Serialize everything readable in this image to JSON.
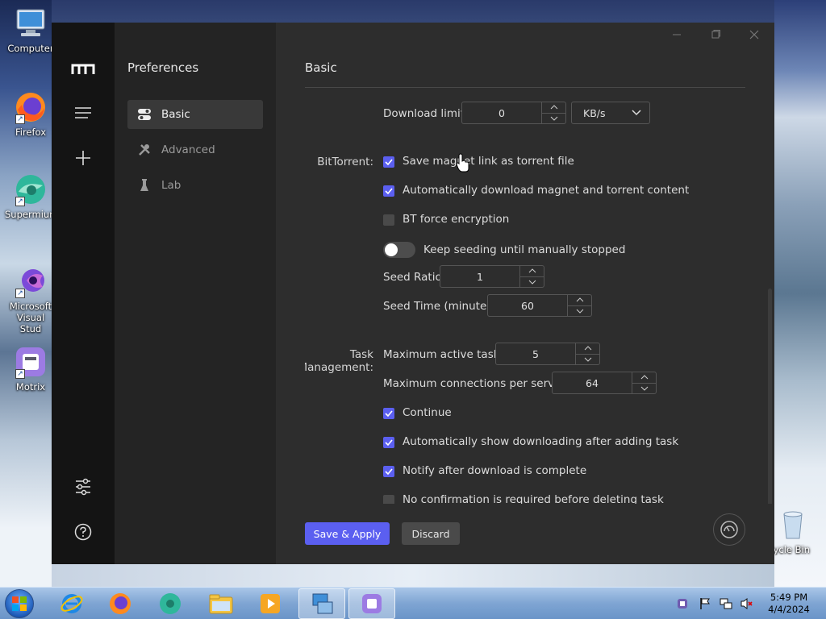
{
  "desktop": {
    "icons": [
      {
        "label": "Computer"
      },
      {
        "label": "Firefox"
      },
      {
        "label": "Supermium"
      },
      {
        "label": "Microsoft Visual Stud"
      },
      {
        "label": "Motrix"
      },
      {
        "label": "Recycle Bin"
      }
    ]
  },
  "app": {
    "sidebar_nav_title": "Preferences",
    "nav_items": [
      {
        "label": "Basic",
        "icon": "toggle-switches-icon",
        "active": true
      },
      {
        "label": "Advanced",
        "icon": "wrench-screwdriver-icon",
        "active": false
      },
      {
        "label": "Lab",
        "icon": "flask-icon",
        "active": false
      }
    ],
    "page_title": "Basic",
    "download_limit": {
      "label": "Download limit",
      "value": "0",
      "unit": "KB/s"
    },
    "bittorrent": {
      "label": "BitTorrent:",
      "save_magnet": "Save magnet link as torrent file",
      "auto_download": "Automatically download magnet and torrent content",
      "force_encryption": "BT force encryption",
      "keep_seeding": "Keep seeding until manually stopped",
      "seed_ratio_label": "Seed Ratio",
      "seed_ratio_value": "1",
      "seed_time_label": "Seed Time (minutes)",
      "seed_time_value": "60"
    },
    "task_management": {
      "label": "Task Management:",
      "max_active_label": "Maximum active tasks",
      "max_active_value": "5",
      "max_conn_label": "Maximum connections per server",
      "max_conn_value": "64",
      "continue": "Continue",
      "auto_show": "Automatically show downloading after adding task",
      "notify": "Notify after download is complete",
      "no_confirm": "No confirmation is required before deleting task"
    },
    "buttons": {
      "save": "Save & Apply",
      "discard": "Discard"
    },
    "colors": {
      "accent": "#5b5ff0",
      "bg": "#2d2d2d",
      "rail": "#141414"
    }
  },
  "taskbar": {
    "time": "5:49 PM",
    "date": "4/4/2024"
  }
}
